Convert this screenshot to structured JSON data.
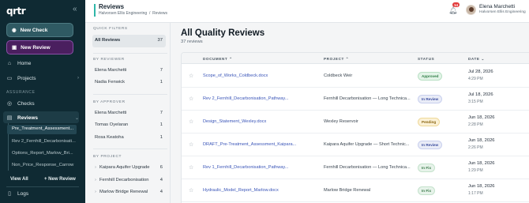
{
  "sidebar": {
    "logo": "qrtr",
    "collapse_icon": "double-chevron-left",
    "new_check": "New Check",
    "new_review": "New Review",
    "home": "Home",
    "projects": "Projects",
    "assurance_label": "ASSURANCE",
    "checks": "Checks",
    "reviews": "Reviews",
    "sub_items": [
      "Pre_Treatment_Assessment...",
      "Rev 2_Fernhill_Decarbonisati...",
      "Options_Report_Marlow_Bri...",
      "Non_Price_Response_Carrow"
    ],
    "view_all": "View All",
    "new_review_link": "+ New Review",
    "logs": "Logs"
  },
  "header": {
    "title": "Reviews",
    "org": "Halvorsen Ellis Engineering",
    "crumb_sep": "/",
    "crumb_page": "Reviews",
    "notifications": "14",
    "user_name": "Elena Marchetti",
    "user_org": "Halvorsen Ellis Engineering"
  },
  "filters": {
    "quick_label": "QUICK FILTERS",
    "all_reviews": "All Reviews",
    "all_count": "37",
    "reviewer_label": "BY REVIEWER",
    "reviewers": [
      {
        "name": "Elena Marchetti",
        "count": "7"
      },
      {
        "name": "Nadia Fenwick",
        "count": "1"
      }
    ],
    "approver_label": "BY APPROVER",
    "approvers": [
      {
        "name": "Elena Marchetti",
        "count": "7"
      },
      {
        "name": "Tomas Oyelaran",
        "count": "1"
      },
      {
        "name": "Rosa Keatoha",
        "count": "1"
      }
    ],
    "project_label": "BY PROJECT",
    "projects": [
      {
        "name": "Kaipara Aquifer Upgrade",
        "count": "6"
      },
      {
        "name": "Fernhill Decarbonisation",
        "count": "4"
      },
      {
        "name": "Marlow Bridge Renewal",
        "count": "4"
      }
    ]
  },
  "main": {
    "title": "All Quality Reviews",
    "count": "37 reviews",
    "columns": {
      "document": "DOCUMENT",
      "project": "PROJECT",
      "status": "STATUS",
      "date": "DATE"
    },
    "rows": [
      {
        "document": "Scope_of_Works_Coldbeck.docx",
        "project": "Coldbeck Weir",
        "status": "Approved",
        "status_kind": "approved",
        "date": "Jul 28, 2026",
        "time": "4:29 PM"
      },
      {
        "document": "Rev 2_Fernhill_Decarbonisation_Pathway...",
        "project": "Fernhill Decarbonisation — Long Technica...",
        "status": "In Review",
        "status_kind": "inreview",
        "date": "Jul 18, 2026",
        "time": "3:15 PM"
      },
      {
        "document": "Design_Statement_Wexley.docx",
        "project": "Wexley Reservoir",
        "status": "Pending",
        "status_kind": "pending",
        "date": "Jun 18, 2026",
        "time": "2:28 PM"
      },
      {
        "document": "DRAFT_Pre-Treatment_Assessment_Kaipara...",
        "project": "Kaipara Aquifer Upgrade — Short Technic...",
        "status": "In Review",
        "status_kind": "inreview",
        "date": "Jun 18, 2026",
        "time": "2:26 PM"
      },
      {
        "document": "Rev 1_Fernhill_Decarbonisation_Pathway...",
        "project": "Fernhill Decarbonisation — Long Technica...",
        "status": "In Fix",
        "status_kind": "infix",
        "date": "Jun 18, 2026",
        "time": "1:29 PM"
      },
      {
        "document": "Hydraulic_Model_Report_Marlow.docx",
        "project": "Marlow Bridge Renewal",
        "status": "In Fix",
        "status_kind": "infix",
        "date": "Jun 18, 2026",
        "time": "1:17 PM"
      }
    ]
  }
}
